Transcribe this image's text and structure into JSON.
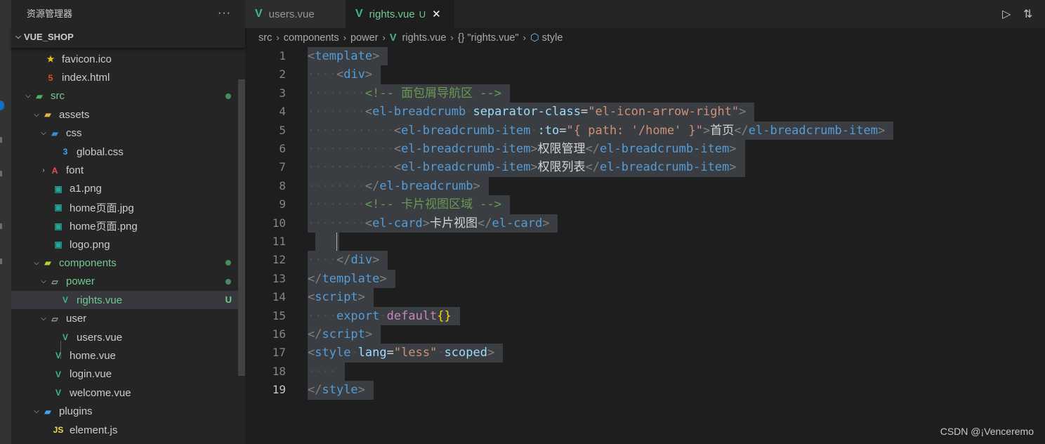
{
  "sidebar": {
    "title": "资源管理器",
    "more": "···",
    "section": "VUE_SHOP",
    "items": [
      {
        "label": "favicon.ico",
        "icon": "star-icon",
        "color": "#f1c40f"
      },
      {
        "label": "index.html",
        "icon": "html5-icon",
        "color": "#e44d26"
      },
      {
        "label": "src",
        "icon": "folder-src-icon",
        "color": "#4fb062"
      },
      {
        "label": "assets",
        "icon": "folder-open-icon",
        "color": "#e8b04a"
      },
      {
        "label": "css",
        "icon": "folder-css-icon",
        "color": "#3f8ad8"
      },
      {
        "label": "global.css",
        "icon": "css3-icon",
        "color": "#42a5f5"
      },
      {
        "label": "font",
        "icon": "folder-font-icon",
        "color": "#ef5350"
      },
      {
        "label": "a1.png",
        "icon": "image-icon",
        "color": "#26a69a"
      },
      {
        "label": "home页面.jpg",
        "icon": "image-icon",
        "color": "#26a69a"
      },
      {
        "label": "home页面.png",
        "icon": "image-icon",
        "color": "#26a69a"
      },
      {
        "label": "logo.png",
        "icon": "image-icon",
        "color": "#26a69a"
      },
      {
        "label": "components",
        "icon": "folder-components-icon",
        "color": "#c0ca33"
      },
      {
        "label": "power",
        "icon": "folder-open-icon",
        "color": "#90a4ae"
      },
      {
        "label": "rights.vue",
        "icon": "vue-icon",
        "color": "#41b883",
        "badge": "U"
      },
      {
        "label": "user",
        "icon": "folder-open-icon",
        "color": "#90a4ae"
      },
      {
        "label": "users.vue",
        "icon": "vue-icon",
        "color": "#41b883"
      },
      {
        "label": "home.vue",
        "icon": "vue-icon",
        "color": "#41b883"
      },
      {
        "label": "login.vue",
        "icon": "vue-icon",
        "color": "#41b883"
      },
      {
        "label": "welcome.vue",
        "icon": "vue-icon",
        "color": "#41b883"
      },
      {
        "label": "plugins",
        "icon": "folder-plugins-icon",
        "color": "#42a5f5"
      },
      {
        "label": "element.js",
        "icon": "js-icon",
        "color": "#f0db4f"
      }
    ]
  },
  "tabs": [
    {
      "label": "users.vue"
    },
    {
      "label": "rights.vue",
      "status": "U",
      "close": "✕"
    }
  ],
  "breadcrumb": {
    "parts": [
      "src",
      "components",
      "power",
      "rights.vue",
      "\"rights.vue\"",
      "style"
    ],
    "braces": "{}"
  },
  "editor": {
    "line_numbers": [
      "1",
      "2",
      "3",
      "4",
      "5",
      "6",
      "7",
      "8",
      "9",
      "10",
      "11",
      "12",
      "13",
      "14",
      "15",
      "16",
      "17",
      "18",
      "19"
    ],
    "active_line": "19"
  },
  "code": {
    "l1": {
      "tag": "template"
    },
    "l2": {
      "tag": "div"
    },
    "l3": {
      "comment": "<!-- 面包屑导航区 -->"
    },
    "l4": {
      "tag": "el-breadcrumb",
      "attr": "separator-class",
      "value": "\"el-icon-arrow-right\""
    },
    "l5": {
      "tag": "el-breadcrumb-item",
      "attr": ":to",
      "value": "\"{ path: '/home' }\"",
      "text": "首页"
    },
    "l6": {
      "tag": "el-breadcrumb-item",
      "text": "权限管理"
    },
    "l7": {
      "tag": "el-breadcrumb-item",
      "text": "权限列表"
    },
    "l8": {
      "tag": "el-breadcrumb"
    },
    "l9": {
      "comment": "<!-- 卡片视图区域 -->"
    },
    "l10": {
      "tag": "el-card",
      "text": "卡片视图"
    },
    "l12": {
      "tag": "div"
    },
    "l13": {
      "tag": "template"
    },
    "l14": {
      "tag": "script"
    },
    "l15": {
      "kw1": "export",
      "kw2": "default",
      "braces": "{}"
    },
    "l16": {
      "tag": "script"
    },
    "l17": {
      "tag": "style",
      "attr": "lang",
      "value": "\"less\"",
      "attr2": "scoped"
    },
    "l19": {
      "tag": "style"
    }
  },
  "watermark": "CSDN @¡Venceremo"
}
